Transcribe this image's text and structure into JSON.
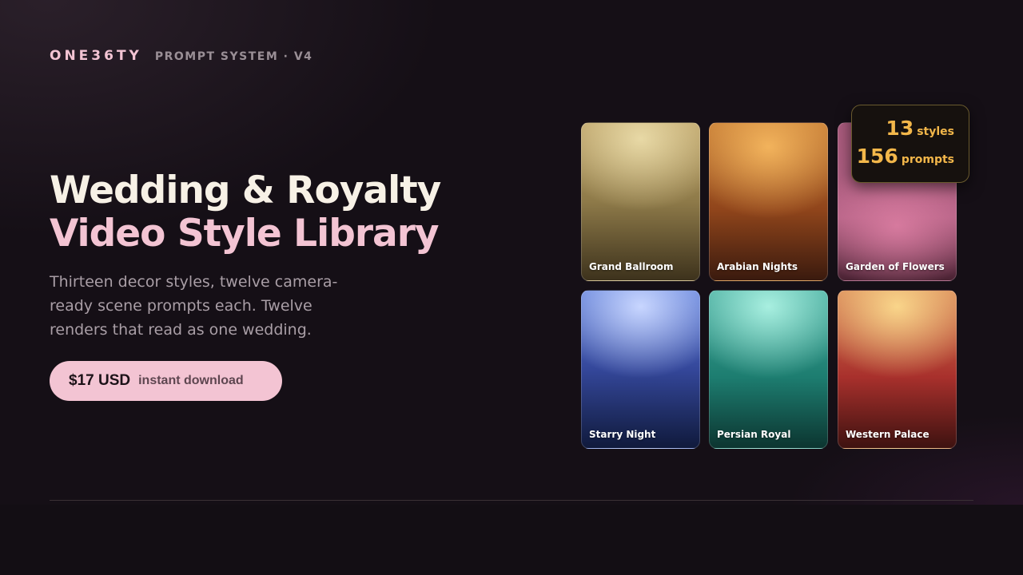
{
  "brand": {
    "name": "ONE36TY",
    "subtitle": "PROMPT SYSTEM · V4"
  },
  "hero": {
    "title_main": "Wedding & Royalty ",
    "title_accent": "Video Style Library",
    "description": "Thirteen decor styles, twelve camera-ready scene prompts each. Twelve renders that read as one wedding."
  },
  "cta": {
    "price": "$17 USD",
    "note": "instant download"
  },
  "stats": {
    "styles_count": "13",
    "styles_label": "styles",
    "prompts_count": "156",
    "prompts_label": "prompts"
  },
  "styles": [
    {
      "label": "Grand Ballroom",
      "color": "#b89d62"
    },
    {
      "label": "Arabian Nights",
      "color": "#c27832"
    },
    {
      "label": "Garden of Flowers",
      "color": "#b05f82"
    },
    {
      "label": "Starry Night",
      "color": "#34479a"
    },
    {
      "label": "Persian Royal",
      "color": "#1d7d70"
    },
    {
      "label": "Western Palace",
      "color": "#a8302c"
    }
  ],
  "colors": {
    "accent_pink": "#f3c4d3",
    "accent_gold": "#f3b74a",
    "background": "#130e14"
  }
}
